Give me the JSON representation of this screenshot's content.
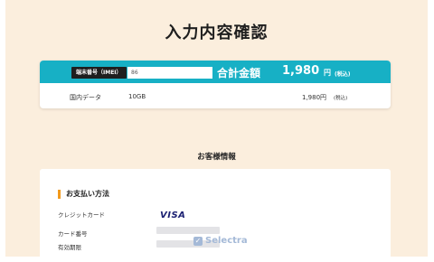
{
  "page": {
    "title": "入力内容確認"
  },
  "summary": {
    "imei_label": "端末番号（IMEI）",
    "imei_value": "86",
    "total_label": "合計金額",
    "total_amount": "1,980",
    "total_yen": "円",
    "total_tax": "(税込)",
    "line_item": {
      "name": "国内データ",
      "plan": "10GB",
      "price": "1,980円",
      "tax": "(税込)"
    }
  },
  "customer": {
    "section_heading": "お客様情報",
    "payment_heading": "お支払い方法",
    "fields": [
      {
        "label": "クレジットカード"
      },
      {
        "label": "カード番号"
      },
      {
        "label": "有効期限"
      }
    ],
    "card_brand": "VISA"
  },
  "watermark": {
    "text": "Selectra",
    "icon": "selectra-check-icon"
  },
  "colors": {
    "background": "#fbeedd",
    "accent_bar": "#17b0c5",
    "heading_marker": "#f29a1d",
    "visa_blue": "#1a1f71"
  }
}
